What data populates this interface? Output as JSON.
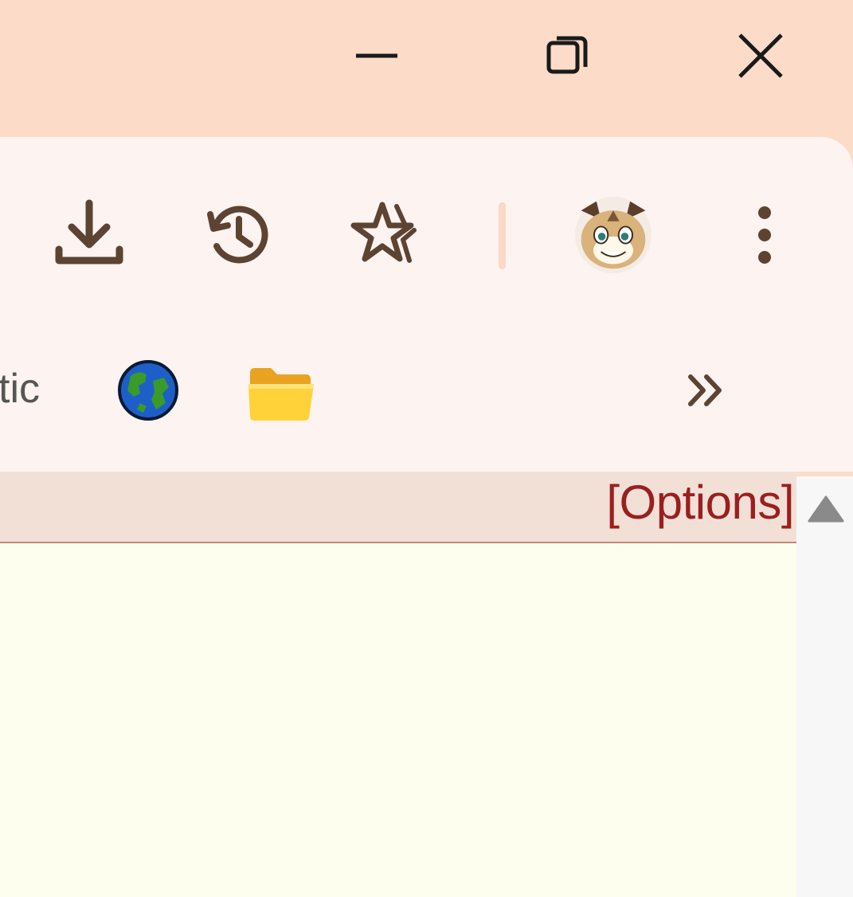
{
  "window_controls": {
    "minimize": "minimize",
    "restore": "restore",
    "close": "close"
  },
  "toolbar": {
    "icons": [
      "download-icon",
      "history-icon",
      "favorites-icon",
      "profile-avatar",
      "more-menu-icon"
    ]
  },
  "bookmarks": {
    "partial_label": "tic",
    "more": "»"
  },
  "page": {
    "options_label": "[Options]"
  },
  "colors": {
    "titlebar": "#fcdcc9",
    "toolbar": "#fdf3f0",
    "icon": "#5c4332",
    "options_link": "#9a1f1f",
    "content": "#fefeee"
  }
}
